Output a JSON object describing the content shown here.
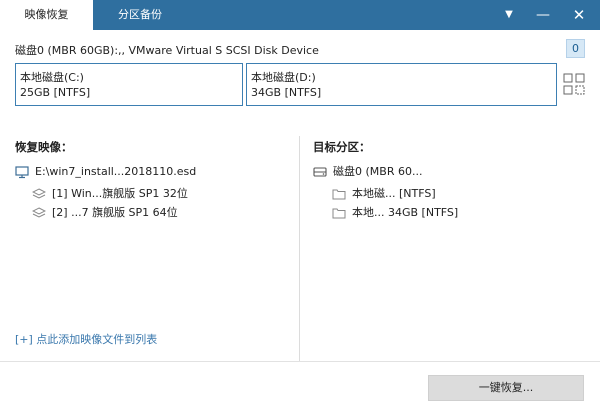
{
  "tabs": [
    {
      "label": "映像恢复"
    },
    {
      "label": "分区备份"
    }
  ],
  "window": {
    "menu_glyph": "▼",
    "min_glyph": "—",
    "close_glyph": "✕"
  },
  "disk": {
    "title": "磁盘0 (MBR 60GB):,, VMware Virtual S SCSI Disk Device",
    "badge": "0",
    "partitions": [
      {
        "name": "本地磁盘(C:)",
        "info": "25GB [NTFS]"
      },
      {
        "name": "本地磁盘(D:)",
        "info": "34GB [NTFS]"
      }
    ]
  },
  "restore_image": {
    "label": "恢复映像：",
    "file": "E:\\win7_install...2018110.esd",
    "items": [
      "[1] Win...旗舰版 SP1 32位",
      "[2] ...7 旗舰版 SP1 64位"
    ],
    "add_link": "[+] 点此添加映像文件到列表"
  },
  "target_partition": {
    "label": "目标分区：",
    "disk": "磁盘0 (MBR 60...",
    "items": [
      "本地磁... [NTFS]",
      "本地... 34GB [NTFS]"
    ]
  },
  "footer": {
    "button": "一键恢复..."
  },
  "colors": {
    "titlebar": "#2f6f9f",
    "accent": "#3d7fb2",
    "link": "#3a78ad"
  }
}
